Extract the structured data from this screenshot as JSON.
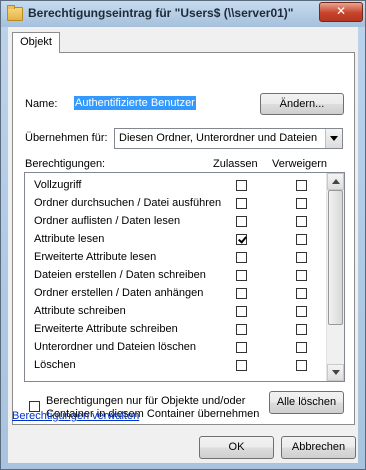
{
  "window": {
    "title": "Berechtigungseintrag für \"Users$ (\\\\server01)\"",
    "close_glyph": "✕"
  },
  "tabs": [
    {
      "label": "Objekt"
    }
  ],
  "name": {
    "label": "Name:",
    "value": "Authentifizierte Benutzer",
    "change_button": "Ändern..."
  },
  "apply_to": {
    "label": "Übernehmen für:",
    "selected": "Diesen Ordner, Unterordner und Dateien"
  },
  "permissions": {
    "header_label": "Berechtigungen:",
    "col_allow": "Zulassen",
    "col_deny": "Verweigern",
    "rows": [
      {
        "label": "Vollzugriff",
        "allow": false,
        "deny": false
      },
      {
        "label": "Ordner durchsuchen / Datei ausführen",
        "allow": false,
        "deny": false
      },
      {
        "label": "Ordner auflisten / Daten lesen",
        "allow": false,
        "deny": false
      },
      {
        "label": "Attribute lesen",
        "allow": true,
        "deny": false
      },
      {
        "label": "Erweiterte Attribute lesen",
        "allow": false,
        "deny": false
      },
      {
        "label": "Dateien erstellen / Daten schreiben",
        "allow": false,
        "deny": false
      },
      {
        "label": "Ordner erstellen / Daten anhängen",
        "allow": false,
        "deny": false
      },
      {
        "label": "Attribute schreiben",
        "allow": false,
        "deny": false
      },
      {
        "label": "Erweiterte Attribute schreiben",
        "allow": false,
        "deny": false
      },
      {
        "label": "Unterordner und Dateien löschen",
        "allow": false,
        "deny": false
      },
      {
        "label": "Löschen",
        "allow": false,
        "deny": false
      }
    ]
  },
  "apply_only": {
    "line1": "Berechtigungen nur für Objekte und/oder",
    "line2": "Container in diesem Container übernehmen",
    "checked": false
  },
  "clear_all_button": "Alle löschen",
  "manage_link": "Berechtigungen verwalten",
  "footer": {
    "ok": "OK",
    "cancel": "Abbrechen"
  }
}
